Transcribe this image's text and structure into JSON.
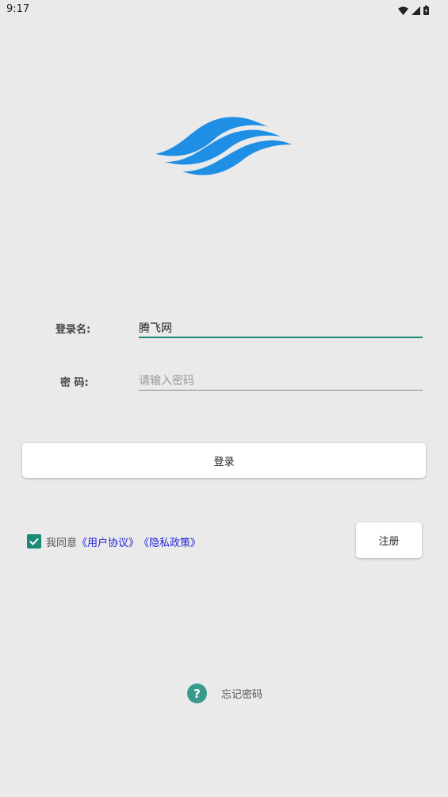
{
  "status_bar": {
    "time": "9:17",
    "icons": [
      "wifi-icon",
      "signal-icon",
      "battery-icon"
    ]
  },
  "logo": {
    "icon": "waves-logo",
    "color": "#1f8fe6"
  },
  "login_form": {
    "username_label": "登录名:",
    "username_value": "腾飞网",
    "password_label": "密 码:",
    "password_placeholder": "请输入密码",
    "password_value": ""
  },
  "login_button_label": "登录",
  "agreement": {
    "checked": true,
    "prefix": "我同意",
    "user_agreement_link": "《用户协议》",
    "privacy_policy_link": "《隐私政策》"
  },
  "register_button_label": "注册",
  "forgot_password": {
    "icon": "help-icon",
    "label": "忘记密码"
  },
  "colors": {
    "accent": "#1a8a76",
    "link": "#2626d9",
    "logo": "#1f8fe6",
    "background": "#eaeaea"
  }
}
